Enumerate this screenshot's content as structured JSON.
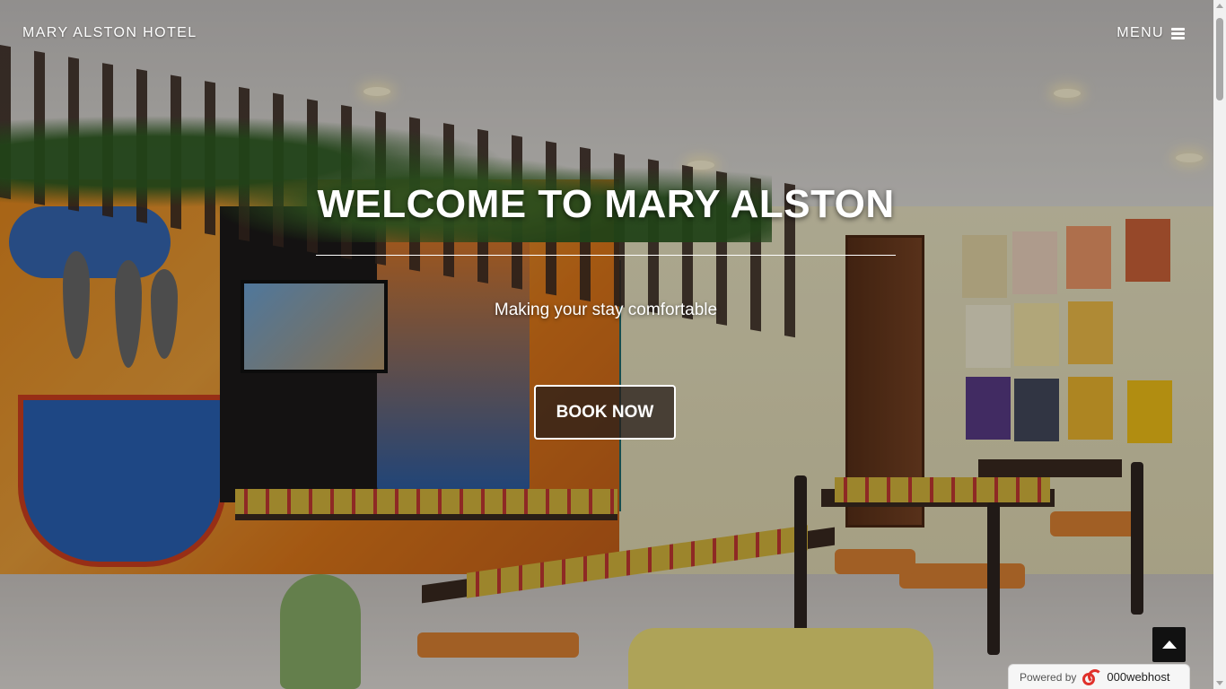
{
  "navbar": {
    "brand": "MARY ALSTON HOTEL",
    "menu_label": "MENU",
    "menu_icon": "bars-icon"
  },
  "hero": {
    "title": "WELCOME TO MARY ALSTON",
    "subtitle": "Making your stay comfortable",
    "cta_label": "BOOK NOW",
    "background": "cafe-dining-room-photo"
  },
  "back_to_top": {
    "icon": "caret-up-icon"
  },
  "powered_badge": {
    "label": "Powered by",
    "host": "000webhost",
    "logo_color": "#e0312b"
  },
  "colors": {
    "text": "#ffffff",
    "button_bg": "#111111"
  }
}
